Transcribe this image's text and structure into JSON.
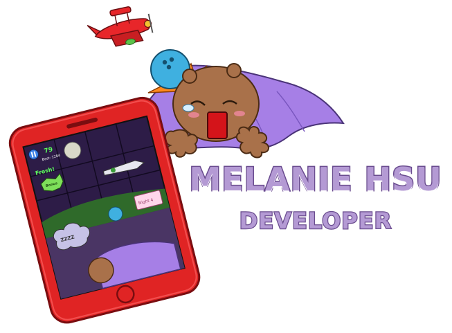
{
  "header": {
    "name": "MELANIE HSU",
    "role": "DEVELOPER"
  },
  "phone_game": {
    "score": "79",
    "score_label": "Best: 1284",
    "status": "Fresh!",
    "badge": "Bonus",
    "sign": "Night 4",
    "sleep_text": "ZZZZ"
  },
  "icons": [
    "biplane-icon",
    "bowling-ball-icon",
    "blob-character-icon",
    "blanket-icon",
    "smartphone-icon",
    "pause-icon",
    "moon-icon",
    "rocket-icon"
  ],
  "colors": {
    "phone_red": "#e02424",
    "phone_dark_red": "#b3161b",
    "title_fill": "#b49ad4",
    "title_stroke": "#6a4c8f",
    "blanket": "#a67fe6",
    "character": "#a9714a",
    "plane_red": "#e8262a",
    "ball_blue": "#3fb0e0",
    "flame": "#ff8a1e"
  }
}
